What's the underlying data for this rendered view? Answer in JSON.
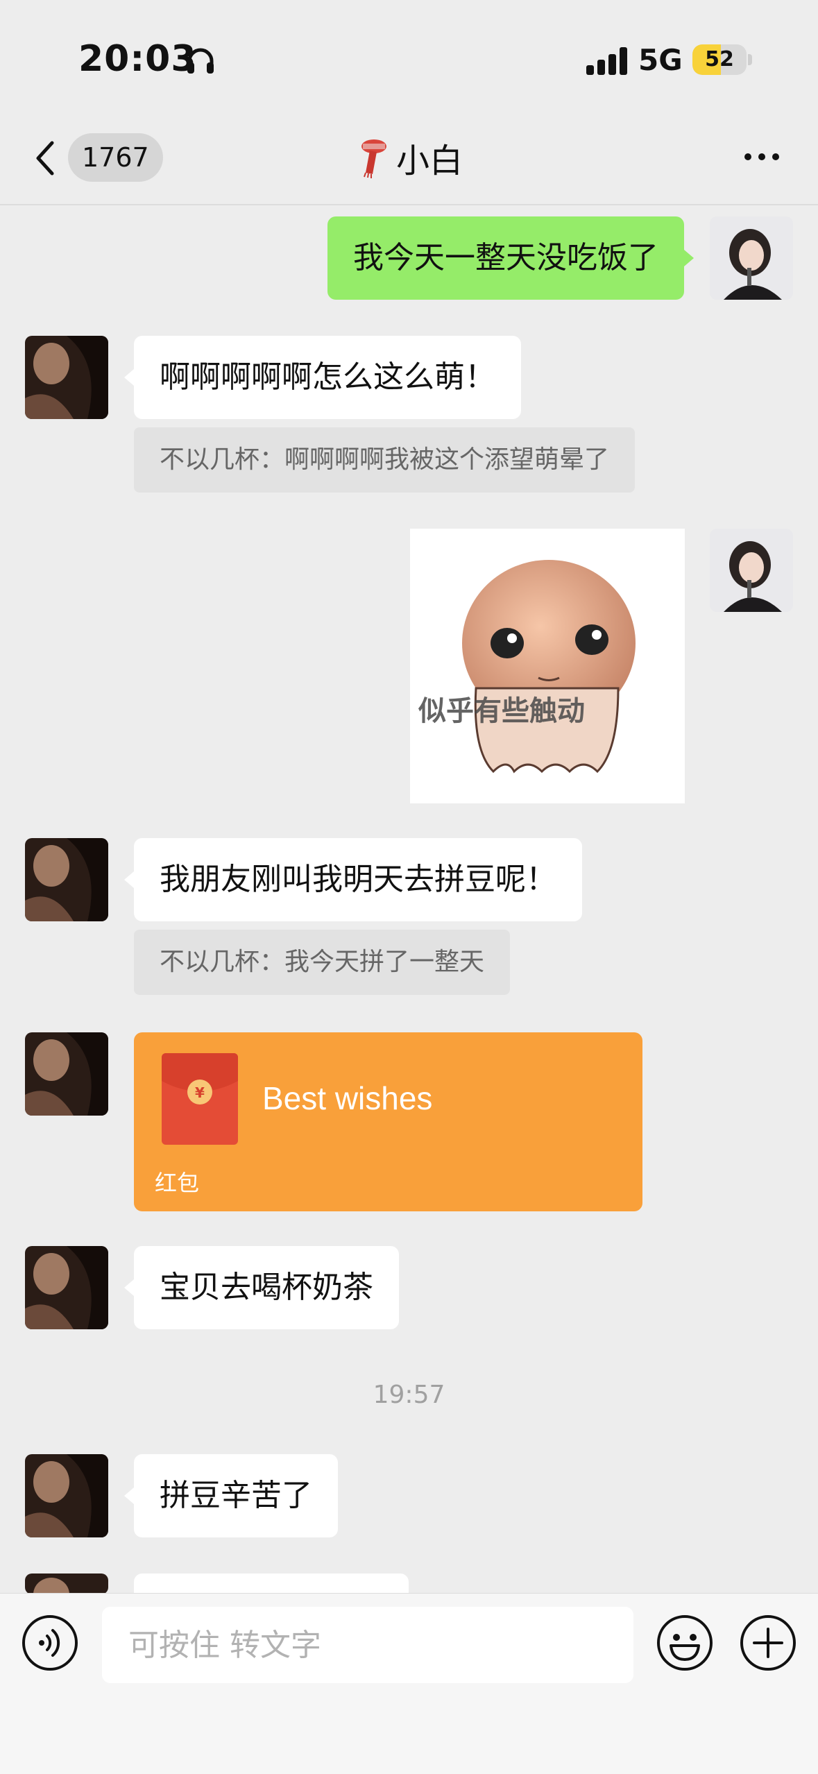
{
  "status_bar": {
    "time": "20:03",
    "network": "5G",
    "battery": "52",
    "battery_level": 0.52
  },
  "header": {
    "unread_count": "1767",
    "title": "小白"
  },
  "messages": [
    {
      "text": "我今天一整天没吃饭了"
    },
    {
      "text": "啊啊啊啊啊怎么这么萌！",
      "quote": "不以几杯：啊啊啊啊我被这个添望萌晕了"
    },
    {
      "sticker_text": "似乎有些触动"
    },
    {
      "text": "我朋友刚叫我明天去拼豆呢！",
      "quote": "不以几杯：我今天拼了一整天"
    },
    {
      "red_packet": {
        "label": "Best wishes",
        "type": "红包"
      }
    },
    {
      "text": "宝贝去喝杯奶茶"
    },
    {
      "text": "拼豆辛苦了"
    }
  ],
  "time_separator": "19:57",
  "input": {
    "placeholder": "可按住 转文字"
  },
  "colors": {
    "background": "#ededed",
    "sent_bubble": "#95ec69",
    "received_bubble": "#ffffff",
    "red_packet": "#f9a03a"
  }
}
